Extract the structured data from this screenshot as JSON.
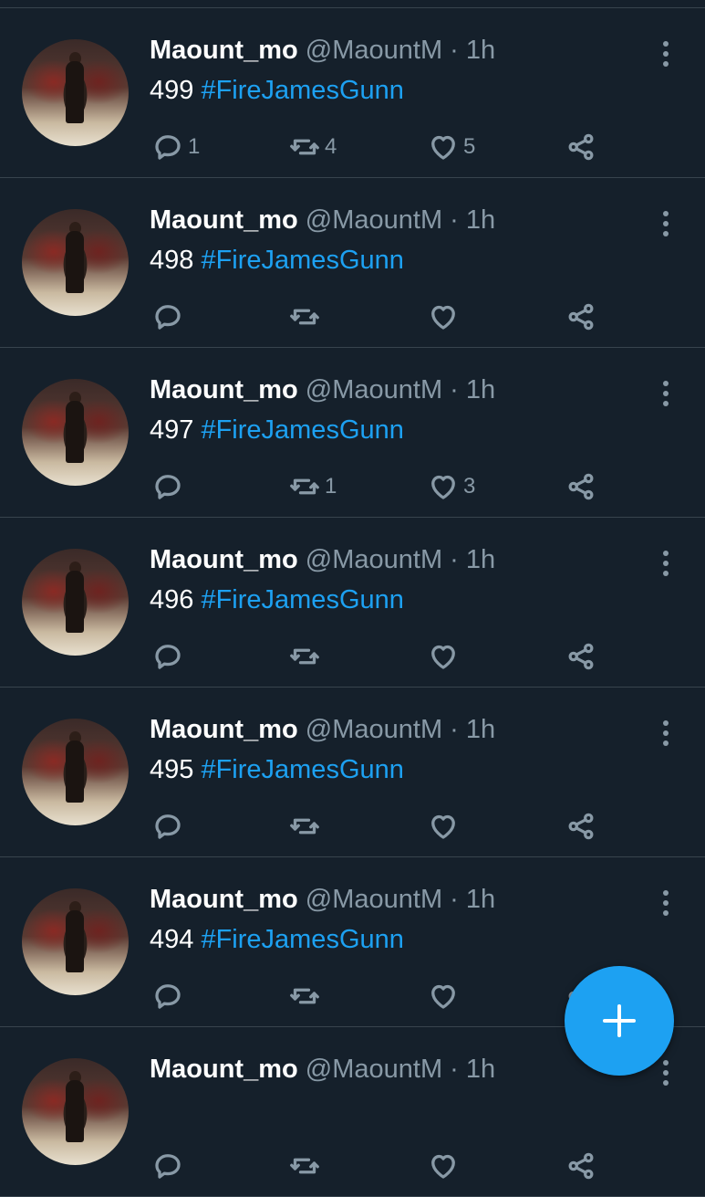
{
  "colors": {
    "background": "#15202b",
    "divider": "#38444d",
    "muted": "#8899a6",
    "accent": "#1da1f2"
  },
  "icons": [
    "chat-bubble-icon",
    "retweet-icon",
    "heart-icon",
    "share-icon",
    "more-vertical-icon",
    "plus-icon"
  ],
  "tweets": [
    {
      "name": "Maount_mo",
      "handle": "@MaountM",
      "dot": "·",
      "time": "1h",
      "number": "499",
      "hashtag": "#FireJamesGunn",
      "replies": "1",
      "retweets": "4",
      "likes": "5"
    },
    {
      "name": "Maount_mo",
      "handle": "@MaountM",
      "dot": "·",
      "time": "1h",
      "number": "498",
      "hashtag": "#FireJamesGunn",
      "replies": "",
      "retweets": "",
      "likes": ""
    },
    {
      "name": "Maount_mo",
      "handle": "@MaountM",
      "dot": "·",
      "time": "1h",
      "number": "497",
      "hashtag": "#FireJamesGunn",
      "replies": "",
      "retweets": "1",
      "likes": "3"
    },
    {
      "name": "Maount_mo",
      "handle": "@MaountM",
      "dot": "·",
      "time": "1h",
      "number": "496",
      "hashtag": "#FireJamesGunn",
      "replies": "",
      "retweets": "",
      "likes": ""
    },
    {
      "name": "Maount_mo",
      "handle": "@MaountM",
      "dot": "·",
      "time": "1h",
      "number": "495",
      "hashtag": "#FireJamesGunn",
      "replies": "",
      "retweets": "",
      "likes": ""
    },
    {
      "name": "Maount_mo",
      "handle": "@MaountM",
      "dot": "·",
      "time": "1h",
      "number": "494",
      "hashtag": "#FireJamesGunn",
      "replies": "",
      "retweets": "",
      "likes": ""
    },
    {
      "name": "Maount_mo",
      "handle": "@MaountM",
      "dot": "·",
      "time": "1h",
      "number": "",
      "hashtag": "",
      "replies": "",
      "retweets": "",
      "likes": ""
    }
  ]
}
